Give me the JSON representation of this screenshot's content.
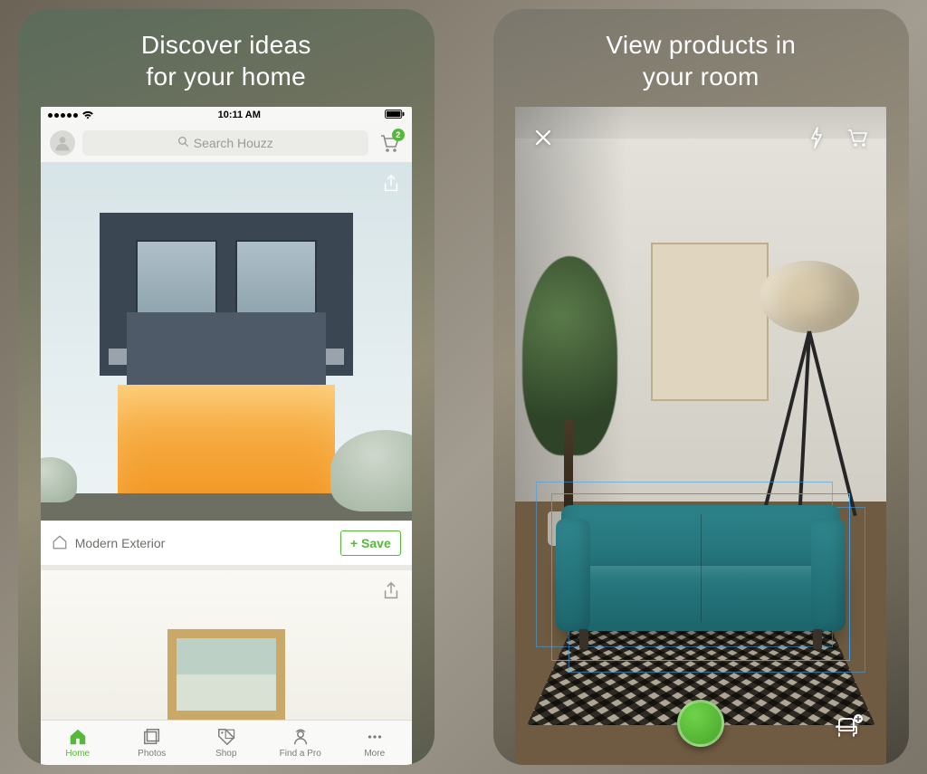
{
  "left": {
    "tagline": "Discover ideas\nfor your home",
    "status": {
      "time": "10:11 AM"
    },
    "topbar": {
      "search_placeholder": "Search Houzz",
      "cart_badge": "2"
    },
    "feed": {
      "card1": {
        "title": "Modern Exterior",
        "save_label": "Save"
      }
    },
    "tabs": [
      {
        "label": "Home"
      },
      {
        "label": "Photos"
      },
      {
        "label": "Shop"
      },
      {
        "label": "Find a Pro"
      },
      {
        "label": "More"
      }
    ]
  },
  "right": {
    "tagline": "View products in\nyour room"
  }
}
